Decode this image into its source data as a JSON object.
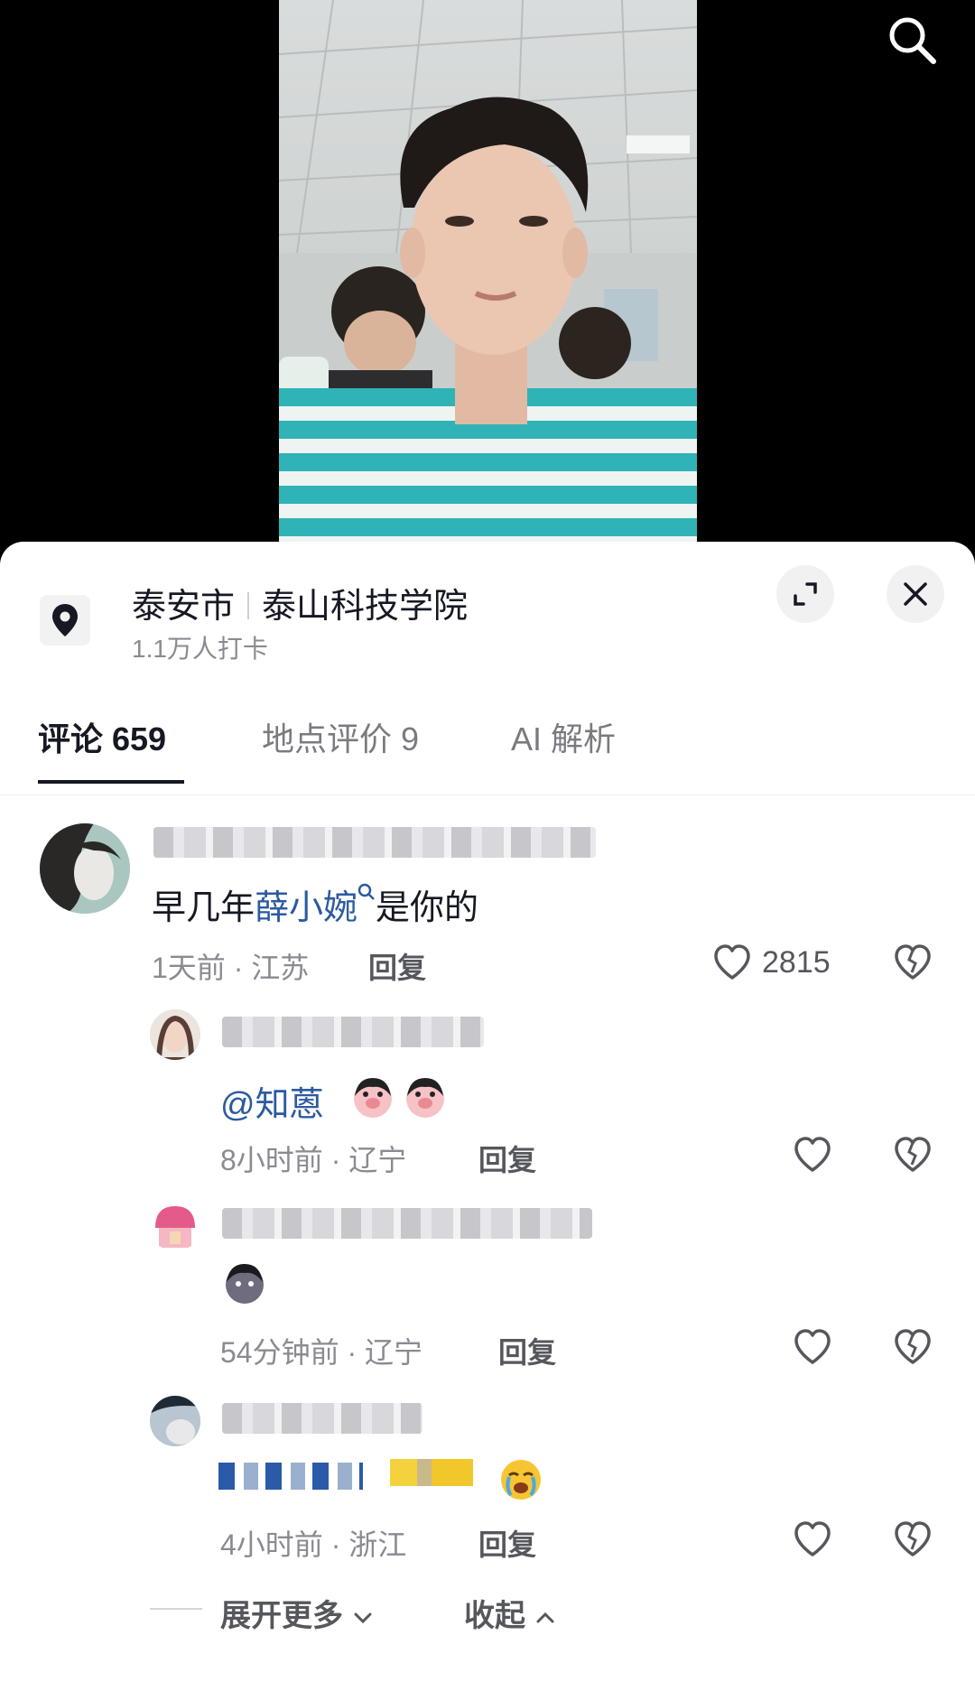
{
  "location": {
    "city": "泰安市",
    "place": "泰山科技学院",
    "checkins": "1.1万人打卡"
  },
  "tabs": {
    "comments": "评论 659",
    "reviews": "地点评价 9",
    "ai": "AI 解析"
  },
  "icons": {
    "search": "search-icon",
    "location": "location-pin-icon",
    "expand": "expand-icon",
    "close": "close-icon",
    "like": "heart-outline-icon",
    "dislike": "broken-heart-icon"
  },
  "comments": [
    {
      "text_prefix": "早几年",
      "mention": "薛小婉",
      "text_suffix": "是你的",
      "time_region": "1天前 · 江苏",
      "reply": "回复",
      "likes": "2815"
    },
    {
      "text": "@知蒽",
      "time_region": "8小时前 · 辽宁",
      "reply": "回复"
    },
    {
      "time_region": "54分钟前 · 辽宁",
      "reply": "回复"
    },
    {
      "time_region": "4小时前 · 浙江",
      "reply": "回复"
    }
  ],
  "footer": {
    "expand_more": "展开更多",
    "collapse": "收起"
  },
  "colors": {
    "text_primary": "#161823",
    "text_secondary": "#8a8b91",
    "mention": "#2c5aa0",
    "sheet_bg": "#ffffff",
    "video_bg": "#000000"
  }
}
